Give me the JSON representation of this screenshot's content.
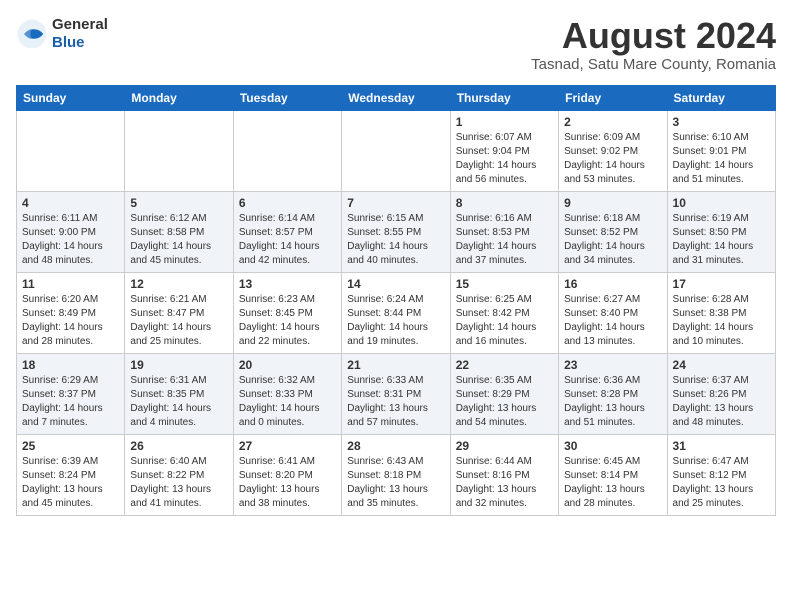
{
  "header": {
    "logo_line1": "General",
    "logo_line2": "Blue",
    "main_title": "August 2024",
    "subtitle": "Tasnad, Satu Mare County, Romania"
  },
  "calendar": {
    "days_of_week": [
      "Sunday",
      "Monday",
      "Tuesday",
      "Wednesday",
      "Thursday",
      "Friday",
      "Saturday"
    ],
    "weeks": [
      [
        {
          "day": "",
          "info": ""
        },
        {
          "day": "",
          "info": ""
        },
        {
          "day": "",
          "info": ""
        },
        {
          "day": "",
          "info": ""
        },
        {
          "day": "1",
          "info": "Sunrise: 6:07 AM\nSunset: 9:04 PM\nDaylight: 14 hours\nand 56 minutes."
        },
        {
          "day": "2",
          "info": "Sunrise: 6:09 AM\nSunset: 9:02 PM\nDaylight: 14 hours\nand 53 minutes."
        },
        {
          "day": "3",
          "info": "Sunrise: 6:10 AM\nSunset: 9:01 PM\nDaylight: 14 hours\nand 51 minutes."
        }
      ],
      [
        {
          "day": "4",
          "info": "Sunrise: 6:11 AM\nSunset: 9:00 PM\nDaylight: 14 hours\nand 48 minutes."
        },
        {
          "day": "5",
          "info": "Sunrise: 6:12 AM\nSunset: 8:58 PM\nDaylight: 14 hours\nand 45 minutes."
        },
        {
          "day": "6",
          "info": "Sunrise: 6:14 AM\nSunset: 8:57 PM\nDaylight: 14 hours\nand 42 minutes."
        },
        {
          "day": "7",
          "info": "Sunrise: 6:15 AM\nSunset: 8:55 PM\nDaylight: 14 hours\nand 40 minutes."
        },
        {
          "day": "8",
          "info": "Sunrise: 6:16 AM\nSunset: 8:53 PM\nDaylight: 14 hours\nand 37 minutes."
        },
        {
          "day": "9",
          "info": "Sunrise: 6:18 AM\nSunset: 8:52 PM\nDaylight: 14 hours\nand 34 minutes."
        },
        {
          "day": "10",
          "info": "Sunrise: 6:19 AM\nSunset: 8:50 PM\nDaylight: 14 hours\nand 31 minutes."
        }
      ],
      [
        {
          "day": "11",
          "info": "Sunrise: 6:20 AM\nSunset: 8:49 PM\nDaylight: 14 hours\nand 28 minutes."
        },
        {
          "day": "12",
          "info": "Sunrise: 6:21 AM\nSunset: 8:47 PM\nDaylight: 14 hours\nand 25 minutes."
        },
        {
          "day": "13",
          "info": "Sunrise: 6:23 AM\nSunset: 8:45 PM\nDaylight: 14 hours\nand 22 minutes."
        },
        {
          "day": "14",
          "info": "Sunrise: 6:24 AM\nSunset: 8:44 PM\nDaylight: 14 hours\nand 19 minutes."
        },
        {
          "day": "15",
          "info": "Sunrise: 6:25 AM\nSunset: 8:42 PM\nDaylight: 14 hours\nand 16 minutes."
        },
        {
          "day": "16",
          "info": "Sunrise: 6:27 AM\nSunset: 8:40 PM\nDaylight: 14 hours\nand 13 minutes."
        },
        {
          "day": "17",
          "info": "Sunrise: 6:28 AM\nSunset: 8:38 PM\nDaylight: 14 hours\nand 10 minutes."
        }
      ],
      [
        {
          "day": "18",
          "info": "Sunrise: 6:29 AM\nSunset: 8:37 PM\nDaylight: 14 hours\nand 7 minutes."
        },
        {
          "day": "19",
          "info": "Sunrise: 6:31 AM\nSunset: 8:35 PM\nDaylight: 14 hours\nand 4 minutes."
        },
        {
          "day": "20",
          "info": "Sunrise: 6:32 AM\nSunset: 8:33 PM\nDaylight: 14 hours\nand 0 minutes."
        },
        {
          "day": "21",
          "info": "Sunrise: 6:33 AM\nSunset: 8:31 PM\nDaylight: 13 hours\nand 57 minutes."
        },
        {
          "day": "22",
          "info": "Sunrise: 6:35 AM\nSunset: 8:29 PM\nDaylight: 13 hours\nand 54 minutes."
        },
        {
          "day": "23",
          "info": "Sunrise: 6:36 AM\nSunset: 8:28 PM\nDaylight: 13 hours\nand 51 minutes."
        },
        {
          "day": "24",
          "info": "Sunrise: 6:37 AM\nSunset: 8:26 PM\nDaylight: 13 hours\nand 48 minutes."
        }
      ],
      [
        {
          "day": "25",
          "info": "Sunrise: 6:39 AM\nSunset: 8:24 PM\nDaylight: 13 hours\nand 45 minutes."
        },
        {
          "day": "26",
          "info": "Sunrise: 6:40 AM\nSunset: 8:22 PM\nDaylight: 13 hours\nand 41 minutes."
        },
        {
          "day": "27",
          "info": "Sunrise: 6:41 AM\nSunset: 8:20 PM\nDaylight: 13 hours\nand 38 minutes."
        },
        {
          "day": "28",
          "info": "Sunrise: 6:43 AM\nSunset: 8:18 PM\nDaylight: 13 hours\nand 35 minutes."
        },
        {
          "day": "29",
          "info": "Sunrise: 6:44 AM\nSunset: 8:16 PM\nDaylight: 13 hours\nand 32 minutes."
        },
        {
          "day": "30",
          "info": "Sunrise: 6:45 AM\nSunset: 8:14 PM\nDaylight: 13 hours\nand 28 minutes."
        },
        {
          "day": "31",
          "info": "Sunrise: 6:47 AM\nSunset: 8:12 PM\nDaylight: 13 hours\nand 25 minutes."
        }
      ]
    ]
  }
}
